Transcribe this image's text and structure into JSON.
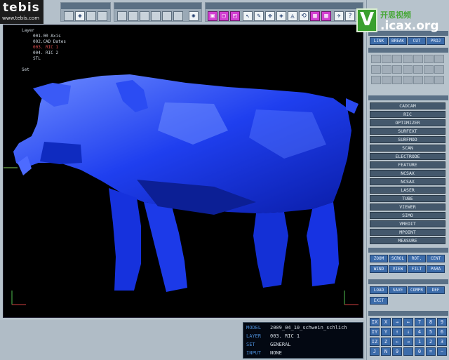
{
  "logo": {
    "word": "tebis",
    "url": "www.tebis.com"
  },
  "watermark": {
    "letter": "V",
    "cn": "开思视频",
    "url": ".icax.org"
  },
  "tree": [
    {
      "text": "Layer",
      "indent": 0,
      "red": false
    },
    {
      "text": "001.00 Axis",
      "indent": 1,
      "red": false
    },
    {
      "text": "002.CAD Dates",
      "indent": 1,
      "red": false
    },
    {
      "text": "003. RIC 1",
      "indent": 1,
      "red": true
    },
    {
      "text": "004. RIC 2",
      "indent": 1,
      "red": false
    },
    {
      "text": "STL",
      "indent": 1,
      "red": false
    },
    {
      "text": "Set",
      "indent": 0,
      "red": false
    }
  ],
  "status": {
    "model_label": "MODEL",
    "model_value": "2009_04_10_schwein_schlich",
    "layer_label": "LAYER",
    "layer_value": "003. RIC 1",
    "set_label": "SET",
    "set_value": "GENERAL",
    "input_label": "INPUT",
    "input_value": "NONE"
  },
  "right_top_buttons": [
    "LINK",
    "BREAK",
    "CUT",
    "PROJ"
  ],
  "menu": [
    "CADCAM",
    "RIC",
    "OPTIMIZER",
    "SURFEXT",
    "SURFMOD",
    "SCAN",
    "ELECTRODE",
    "FEATURE",
    "NCSAX",
    "NCSAX",
    "LASER",
    "TUBE",
    "VIEWER",
    "SIMO",
    "VMEDIT",
    "MPOINT",
    "MEASURE"
  ],
  "view_buttons": [
    "ZOOM",
    "SCROL",
    "ROT.",
    "CENT",
    "WIND",
    "VIEW",
    "FILT",
    "PARA"
  ],
  "file_buttons": [
    "LOAD",
    "SAVE",
    "COMPR",
    "DEF",
    "EXIT"
  ],
  "keypad": [
    "IX",
    "X",
    "→",
    "←",
    "7",
    "8",
    "9",
    "IY",
    "Y",
    "↑",
    "↓",
    "4",
    "5",
    "6",
    "IZ",
    "Z",
    "←",
    "→",
    "1",
    "2",
    "3",
    "J",
    "N",
    "9",
    "",
    "0",
    "=",
    "−"
  ],
  "colors": {
    "model_blue": "#1a3cf0",
    "accent": "#3c6caa"
  }
}
